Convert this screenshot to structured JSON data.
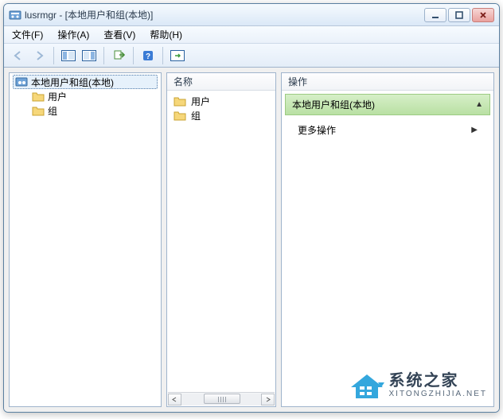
{
  "window": {
    "title": "lusrmgr - [本地用户和组(本地)]"
  },
  "menubar": {
    "file": "文件(F)",
    "action": "操作(A)",
    "view": "查看(V)",
    "help": "帮助(H)"
  },
  "tree": {
    "root": "本地用户和组(本地)",
    "children": [
      "用户",
      "组"
    ]
  },
  "list": {
    "header": "名称",
    "items": [
      "用户",
      "组"
    ]
  },
  "actions": {
    "header": "操作",
    "group_title": "本地用户和组(本地)",
    "more_actions": "更多操作"
  },
  "watermark": {
    "title": "系统之家",
    "url": "XITONGZHIJIA.NET"
  }
}
